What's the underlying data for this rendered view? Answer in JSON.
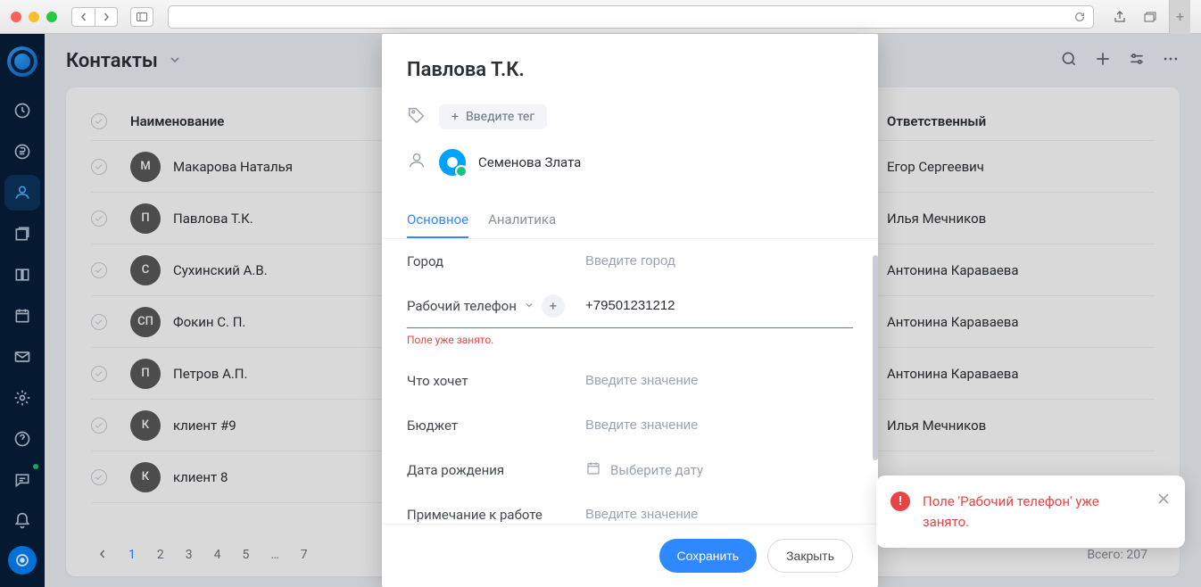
{
  "page": {
    "title": "Контакты"
  },
  "table": {
    "columns": {
      "name": "Наименование",
      "owner": "Ответственный"
    },
    "rows": [
      {
        "initials": "М",
        "name": "Макарова Наталья",
        "owner": "Егор Сергеевич"
      },
      {
        "initials": "П",
        "name": "Павлова Т.К.",
        "owner": "Илья Мечников"
      },
      {
        "initials": "С",
        "name": "Сухинский А.В.",
        "owner": "Антонина Караваева"
      },
      {
        "initials": "СП",
        "name": "Фокин С. П.",
        "owner": "Антонина Караваева"
      },
      {
        "initials": "П",
        "name": "Петров А.П.",
        "owner": "Антонина Караваева"
      },
      {
        "initials": "К",
        "name": "клиент #9",
        "owner": "Илья Мечников"
      },
      {
        "initials": "К",
        "name": "клиент 8",
        "owner": ""
      }
    ]
  },
  "pager": {
    "pages": [
      "1",
      "2",
      "3",
      "4",
      "5",
      "…",
      "7"
    ],
    "active": "1",
    "total_label": "Всего: 207"
  },
  "modal": {
    "title": "Павлова Т.К.",
    "tag_placeholder": "Введите тег",
    "owner_name": "Семенова Злата",
    "tabs": {
      "main": "Основное",
      "analytics": "Аналитика"
    },
    "fields": {
      "city": {
        "label": "Город",
        "placeholder": "Введите город"
      },
      "work_phone": {
        "label": "Рабочий телефон",
        "value": "+79501231212",
        "error": "Поле уже занято."
      },
      "wants": {
        "label": "Что хочет",
        "placeholder": "Введите значение"
      },
      "budget": {
        "label": "Бюджет",
        "placeholder": "Введите значение"
      },
      "birthdate": {
        "label": "Дата рождения",
        "placeholder": "Выберите дату"
      },
      "note": {
        "label": "Примечание к работе",
        "placeholder": "Введите значение"
      }
    },
    "buttons": {
      "save": "Сохранить",
      "close": "Закрыть"
    }
  },
  "toast": {
    "message": "Поле 'Рабочий телефон' уже занято."
  }
}
